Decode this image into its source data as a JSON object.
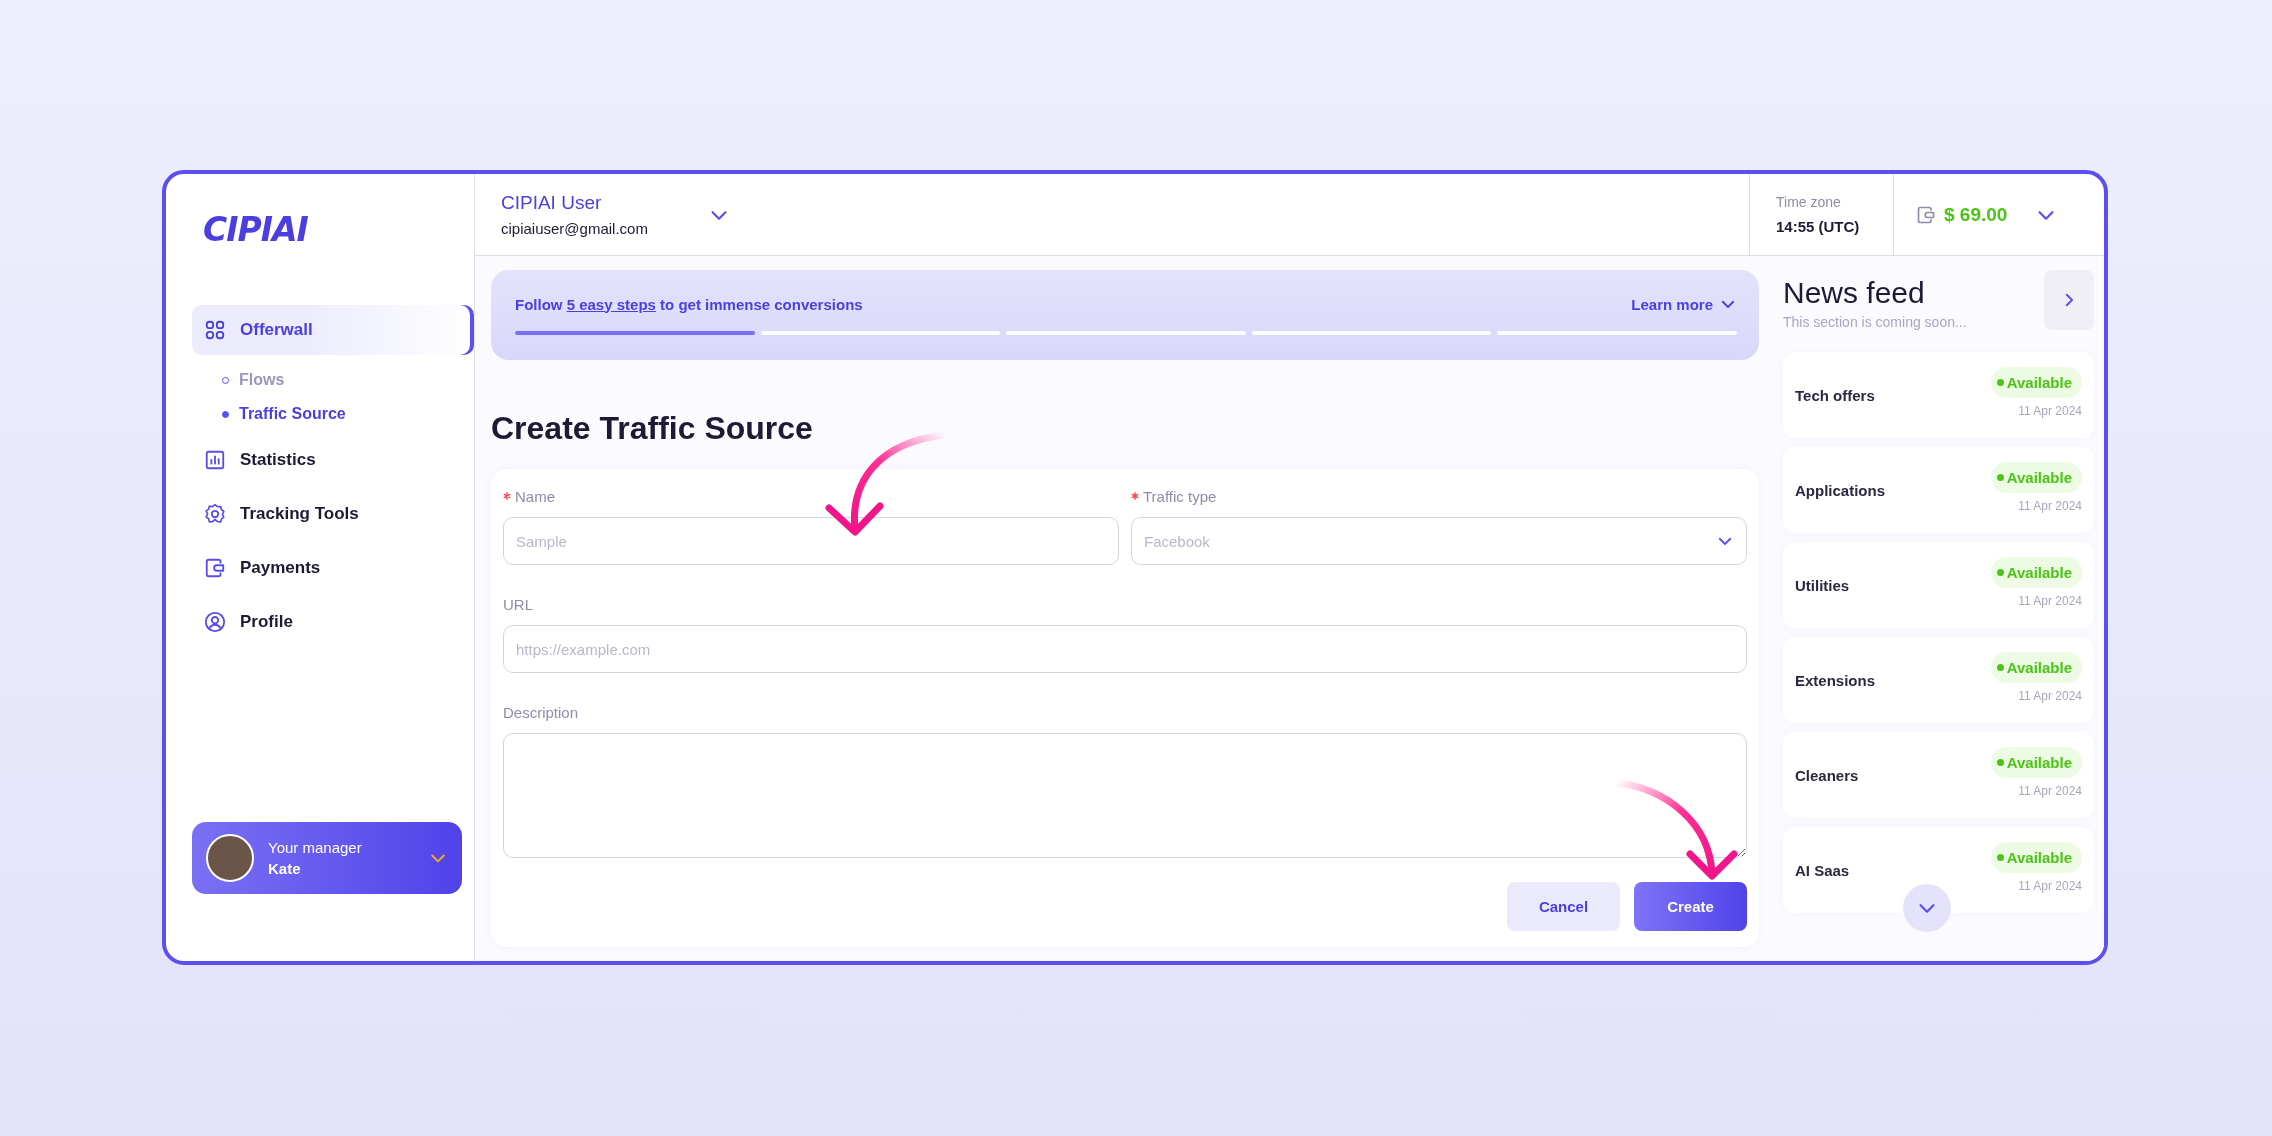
{
  "sidebar": {
    "logo": "CIPIAI",
    "nav": [
      {
        "label": "Offerwall",
        "selected": true,
        "children": [
          {
            "label": "Flows",
            "selected": false
          },
          {
            "label": "Traffic Source",
            "selected": true
          }
        ]
      },
      {
        "label": "Statistics",
        "selected": false
      },
      {
        "label": "Tracking Tools",
        "selected": false
      },
      {
        "label": "Payments",
        "selected": false
      },
      {
        "label": "Profile",
        "selected": false
      }
    ],
    "manager": {
      "caption": "Your manager",
      "name": "Kate"
    }
  },
  "header": {
    "user_name": "CIPIAI User",
    "email": "cipiaiuser@gmail.com",
    "timezone_label": "Time zone",
    "timezone_value": "14:55 (UTC)",
    "balance": "$ 69.00"
  },
  "banner": {
    "prefix": "Follow",
    "link": "5 easy steps",
    "suffix": "to get immense conversions",
    "learn_more": "Learn more",
    "steps": [
      {
        "complete": true
      },
      {
        "complete": false
      },
      {
        "complete": false
      },
      {
        "complete": false
      },
      {
        "complete": false
      }
    ]
  },
  "form": {
    "title": "Create Traffic Source",
    "fields": [
      {
        "kind": "text",
        "label": "Name",
        "required": true,
        "placeholder": "Sample"
      },
      {
        "kind": "select",
        "label": "Traffic type",
        "required": true,
        "placeholder": "Facebook"
      },
      {
        "kind": "text",
        "label": "URL",
        "required": false,
        "placeholder": "https://example.com"
      },
      {
        "kind": "textarea",
        "label": "Description",
        "required": false
      }
    ],
    "buttons": [
      {
        "kind": "secondary",
        "label": "Cancel"
      },
      {
        "kind": "primary",
        "label": "Create"
      }
    ]
  },
  "news": {
    "title": "News feed",
    "subtitle": "This section is coming soon...",
    "items": [
      {
        "title": "Tech offers",
        "status": "Available",
        "date": "11 Apr 2024"
      },
      {
        "title": "Applications",
        "status": "Available",
        "date": "11 Apr 2024"
      },
      {
        "title": "Utilities",
        "status": "Available",
        "date": "11 Apr 2024"
      },
      {
        "title": "Extensions",
        "status": "Available",
        "date": "11 Apr 2024"
      },
      {
        "title": "Cleaners",
        "status": "Available",
        "date": "11 Apr 2024"
      },
      {
        "title": "AI Saas",
        "status": "Available",
        "date": "11 Apr 2024"
      }
    ]
  }
}
